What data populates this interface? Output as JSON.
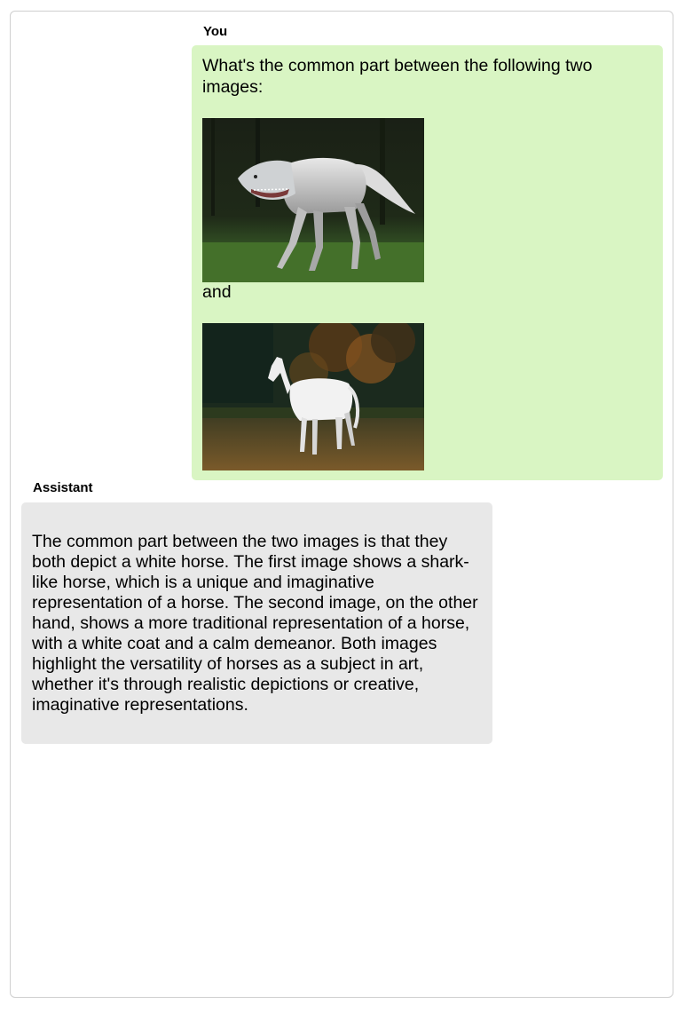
{
  "chat": {
    "user": {
      "sender": "You",
      "text_before": "What's the common part between the following two images:",
      "text_between": "and",
      "images": [
        {
          "icon": "shark-headed-horse-image"
        },
        {
          "icon": "white-horse-image"
        }
      ]
    },
    "assistant": {
      "sender": "Assistant",
      "text": "The common part between the two images is that they both depict a white horse. The first image shows a shark-like horse, which is a unique and imaginative representation of a horse. The second image, on the other hand, shows a more traditional representation of a horse, with a white coat and a calm demeanor. Both images highlight the versatility of horses as a subject in art, whether it's through realistic depictions or creative, imaginative representations."
    }
  },
  "colors": {
    "user_bubble": "#d9f5c3",
    "assistant_bubble": "#e8e8e8",
    "frame_border": "#cfcfcf"
  }
}
